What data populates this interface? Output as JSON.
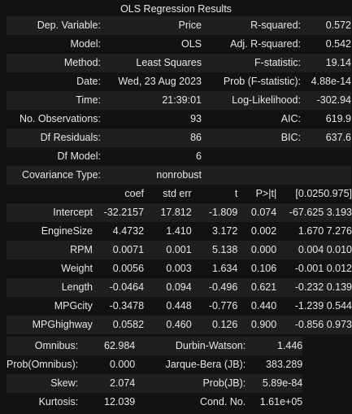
{
  "title": "OLS Regression Results",
  "summary_rows": [
    {
      "l1": "Dep. Variable:",
      "v1": "Price",
      "l2": "R-squared:",
      "v2": "0.572"
    },
    {
      "l1": "Model:",
      "v1": "OLS",
      "l2": "Adj. R-squared:",
      "v2": "0.542"
    },
    {
      "l1": "Method:",
      "v1": "Least Squares",
      "l2": "F-statistic:",
      "v2": "19.14"
    },
    {
      "l1": "Date:",
      "v1": "Wed, 23 Aug 2023",
      "l2": "Prob (F-statistic):",
      "v2": "4.88e-14"
    },
    {
      "l1": "Time:",
      "v1": "21:39:01",
      "l2": "Log-Likelihood:",
      "v2": "-302.94"
    },
    {
      "l1": "No. Observations:",
      "v1": "93",
      "l2": "AIC:",
      "v2": "619.9"
    },
    {
      "l1": "Df Residuals:",
      "v1": "86",
      "l2": "BIC:",
      "v2": "637.6"
    },
    {
      "l1": "Df Model:",
      "v1": "6",
      "l2": "",
      "v2": ""
    },
    {
      "l1": "Covariance Type:",
      "v1": "nonrobust",
      "l2": "",
      "v2": ""
    }
  ],
  "coef_header": [
    "",
    "coef",
    "std err",
    "t",
    "P>|t|",
    "[0.025",
    "0.975]"
  ],
  "coef_rows": [
    [
      "Intercept",
      "-32.2157",
      "17.812",
      "-1.809",
      "0.074",
      "-67.625",
      "3.193"
    ],
    [
      "EngineSize",
      "4.4732",
      "1.410",
      "3.172",
      "0.002",
      "1.670",
      "7.276"
    ],
    [
      "RPM",
      "0.0071",
      "0.001",
      "5.138",
      "0.000",
      "0.004",
      "0.010"
    ],
    [
      "Weight",
      "0.0056",
      "0.003",
      "1.634",
      "0.106",
      "-0.001",
      "0.012"
    ],
    [
      "Length",
      "-0.0464",
      "0.094",
      "-0.496",
      "0.621",
      "-0.232",
      "0.139"
    ],
    [
      "MPGcity",
      "-0.3478",
      "0.448",
      "-0.776",
      "0.440",
      "-1.239",
      "0.544"
    ],
    [
      "MPGhighway",
      "0.0582",
      "0.460",
      "0.126",
      "0.900",
      "-0.856",
      "0.973"
    ]
  ],
  "diag_rows": [
    {
      "l1": "Omnibus:",
      "v1": "62.984",
      "l2": "Durbin-Watson:",
      "v2": "1.446"
    },
    {
      "l1": "Prob(Omnibus):",
      "v1": "0.000",
      "l2": "Jarque-Bera (JB):",
      "v2": "383.289"
    },
    {
      "l1": "Skew:",
      "v1": "2.074",
      "l2": "Prob(JB):",
      "v2": "5.89e-84"
    },
    {
      "l1": "Kurtosis:",
      "v1": "12.039",
      "l2": "Cond. No.",
      "v2": "1.61e+05"
    }
  ]
}
